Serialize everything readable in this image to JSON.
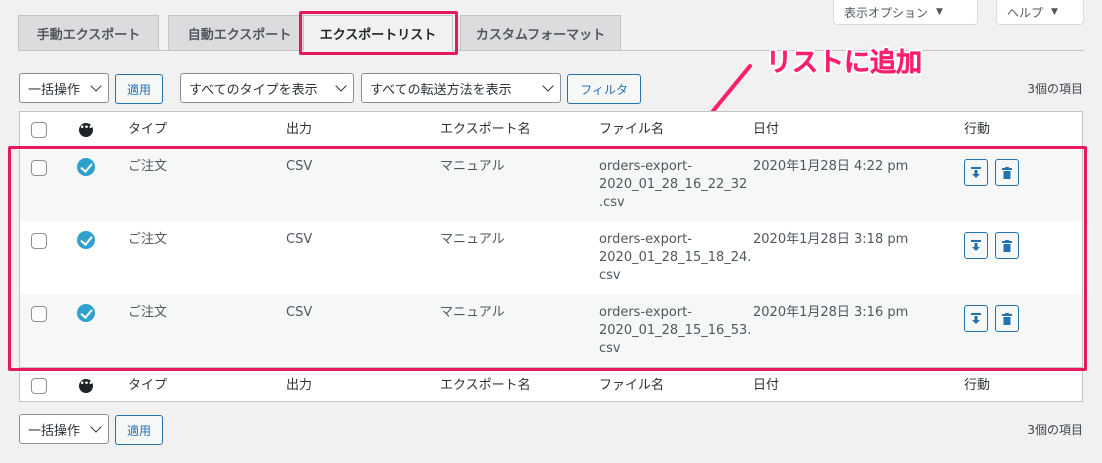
{
  "screen_options": {
    "display_options": "表示オプション",
    "help": "ヘルプ"
  },
  "tabs": [
    {
      "label": "手動エクスポート"
    },
    {
      "label": "自動エクスポート"
    },
    {
      "label": "エクスポートリスト"
    },
    {
      "label": "カスタムフォーマット"
    }
  ],
  "annotation": {
    "label": "リストに追加",
    "color": "#ff1e6e"
  },
  "filters": {
    "bulk_action": "一括操作",
    "apply": "適用",
    "type_filter": "すべてのタイプを表示",
    "transfer_filter": "すべての転送方法を表示",
    "filter_button": "フィルタ",
    "item_count": "3個の項目"
  },
  "table": {
    "columns": {
      "type": "タイプ",
      "output": "出力",
      "export_name": "エクスポート名",
      "file_name": "ファイル名",
      "date": "日付",
      "actions": "行動"
    },
    "rows": [
      {
        "type": "ご注文",
        "output": "CSV",
        "export_name": "マニュアル",
        "file_name": [
          "orders-export-",
          "2020_01_28_16_22_32",
          ".csv"
        ],
        "date": "2020年1月28日 4:22 pm"
      },
      {
        "type": "ご注文",
        "output": "CSV",
        "export_name": "マニュアル",
        "file_name": [
          "orders-export-",
          "2020_01_28_15_18_24.",
          "csv"
        ],
        "date": "2020年1月28日 3:18 pm"
      },
      {
        "type": "ご注文",
        "output": "CSV",
        "export_name": "マニュアル",
        "file_name": [
          "orders-export-",
          "2020_01_28_15_16_53.",
          "csv"
        ],
        "date": "2020年1月28日 3:16 pm"
      }
    ]
  },
  "bottom": {
    "bulk_action": "一括操作",
    "apply": "適用",
    "item_count": "3個の項目"
  },
  "colors": {
    "accent": "#2271b1",
    "highlight": "#e6195b",
    "status": "#2ea2cc"
  }
}
